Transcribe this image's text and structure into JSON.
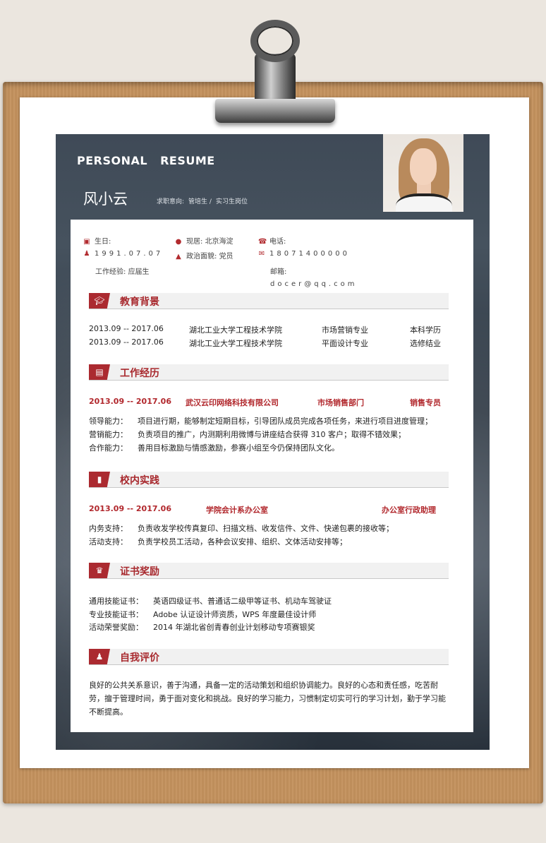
{
  "header": {
    "word1": "PERSONAL",
    "word2": "RESUME",
    "name": "风小云",
    "intent_label": "求职意向:",
    "intent_value": "管培生 /",
    "intent_value2": "实习生岗位"
  },
  "info": {
    "birth_label": "生日:",
    "birth_value": "1991.07.07",
    "residence_label": "现居:",
    "residence_value": "北京海淀",
    "phone_label": "电话:",
    "phone_value": "18071400000",
    "politics_label": "政治面貌:",
    "politics_value": "党员",
    "experience_label": "工作经验:",
    "experience_value": "应届生",
    "email_label": "邮箱:",
    "email_value": "docer@qq.com"
  },
  "sections": {
    "education": "教育背景",
    "work": "工作经历",
    "campus": "校内实践",
    "certs": "证书奖励",
    "self": "自我评价"
  },
  "education": [
    {
      "date": "2013.09 -- 2017.06",
      "school": "湖北工业大学工程技术学院",
      "major": "市场营销专业",
      "degree": "本科学历"
    },
    {
      "date": "2013.09 -- 2017.06",
      "school": "湖北工业大学工程技术学院",
      "major": "平面设计专业",
      "degree": "选修结业"
    }
  ],
  "work": {
    "date": "2013.09 -- 2017.06",
    "company": "武汉云印网络科技有限公司",
    "dept": "市场销售部门",
    "title": "销售专员",
    "items": [
      {
        "label": "领导能力：",
        "text": "项目进行期，能够制定短期目标，引导团队成员完成各项任务，来进行项目进度管理；"
      },
      {
        "label": "营销能力：",
        "text": "负责项目的推广，内测期利用微博与讲座结合获得 310 客户；取得不错效果；"
      },
      {
        "label": "合作能力：",
        "text": "善用目标激励与情感激励，参赛小组至今仍保持团队文化。"
      }
    ]
  },
  "campus": {
    "date": "2013.09 -- 2017.06",
    "org": "学院会计系办公室",
    "title": "办公室行政助理",
    "items": [
      {
        "label": "内务支持：",
        "text": "负责收发学校传真复印、扫描文档、收发信件、文件、快递包裹的接收等；"
      },
      {
        "label": "活动支持：",
        "text": "负责学校员工活动，各种会议安排、组织、文体活动安排等；"
      }
    ]
  },
  "certs": [
    {
      "label": "通用技能证书：",
      "text": "英语四级证书、普通话二级甲等证书、机动车驾驶证"
    },
    {
      "label": "专业技能证书：",
      "text": "Adobe 认证设计师资质，WPS 年度最佳设计师"
    },
    {
      "label": "活动荣誉奖励：",
      "text": "2014 年湖北省创青春创业计划移动专项赛银奖"
    }
  ],
  "self_text": "良好的公共关系意识，善于沟通，具备一定的活动策划和组织协调能力。良好的心态和责任感，吃苦耐劳，擅于管理时间，勇于面对变化和挑战。良好的学习能力，习惯制定切实可行的学习计划，勤于学习能不断提高。"
}
